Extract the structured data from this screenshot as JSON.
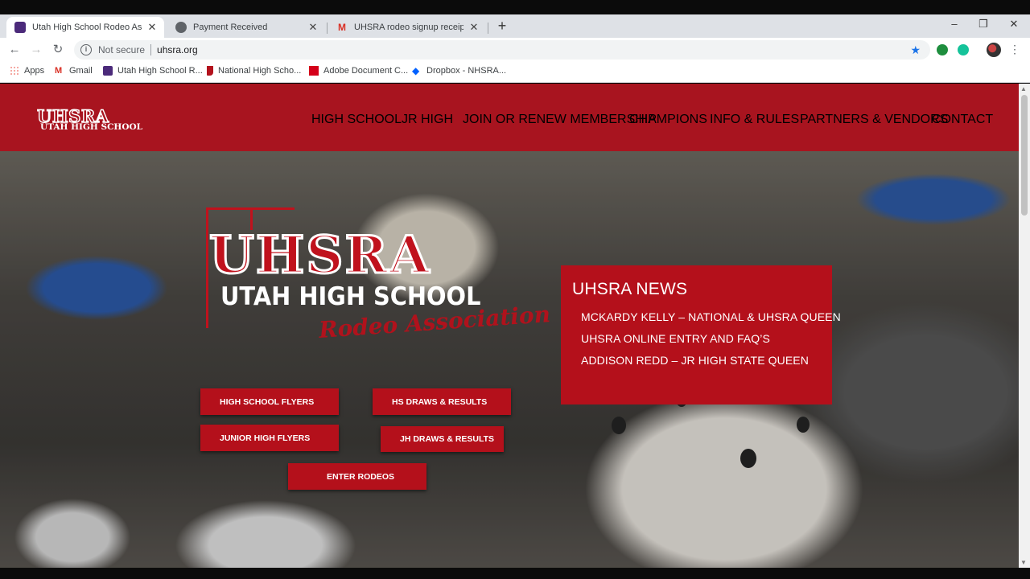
{
  "browser": {
    "tabs": [
      {
        "title": "Utah High School Rodeo Associa",
        "active": true,
        "favicon": "uhsra-favicon-icon"
      },
      {
        "title": "Payment Received",
        "active": false,
        "favicon": "globe-icon"
      },
      {
        "title": "UHSRA rodeo signup receipt - fit",
        "active": false,
        "favicon": "gmail-icon"
      }
    ],
    "address": {
      "security_label": "Not secure",
      "url": "uhsra.org"
    },
    "bookmarks": [
      {
        "label": "Apps",
        "icon": "apps-grid-icon"
      },
      {
        "label": "Gmail",
        "icon": "gmail-icon"
      },
      {
        "label": "Utah High School R...",
        "icon": "uhsra-favicon-icon"
      },
      {
        "label": "National High Scho...",
        "icon": "boot-icon"
      },
      {
        "label": "Adobe Document C...",
        "icon": "adobe-icon"
      },
      {
        "label": "Dropbox - NHSRA...",
        "icon": "dropbox-icon"
      }
    ]
  },
  "site": {
    "logo_line1": "UHSRA",
    "logo_line2": "UTAH HIGH SCHOOL",
    "nav": [
      "HIGH SCHOOL",
      "JR HIGH",
      "JOIN OR RENEW MEMBERSHIP",
      "CHAMPIONS",
      "INFO & RULES",
      "PARTNERS & VENDORS",
      "CONTACT"
    ],
    "hero_logo": {
      "line1": "UHSRA",
      "line2": "UTAH HIGH SCHOOL",
      "line3": "Rodeo Association"
    },
    "buttons": {
      "hs_flyers": "HIGH SCHOOL FLYERS",
      "hs_draws": "HS DRAWS & RESULTS",
      "jr_flyers": "JUNIOR HIGH FLYERS",
      "jh_draws": "JH DRAWS & RESULTS",
      "enter": "ENTER RODEOS"
    },
    "news": {
      "title": "UHSRA NEWS",
      "items": [
        "MCKARDY KELLY – NATIONAL & UHSRA QUEEN",
        "UHSRA ONLINE ENTRY AND FAQ’S",
        "ADDISON REDD – JR HIGH STATE QUEEN"
      ]
    }
  },
  "colors": {
    "brand_red": "#a8141f",
    "button_red": "#b4101b"
  }
}
